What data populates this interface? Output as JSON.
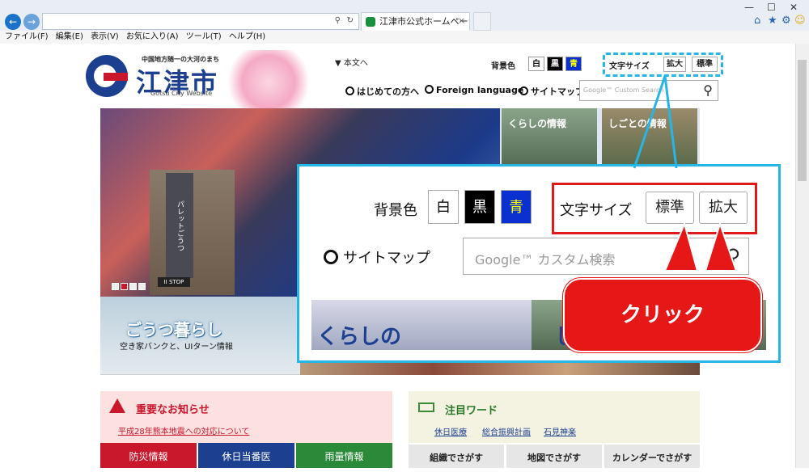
{
  "browser": {
    "back_icon": "back-arrow-icon",
    "forward_icon": "forward-arrow-icon",
    "tab_title": "江津市公式ホームページ",
    "menu": [
      "ファイル(F)",
      "編集(E)",
      "表示(V)",
      "お気に入り(A)",
      "ツール(T)",
      "ヘルプ(H)"
    ]
  },
  "header": {
    "tagline": "中国地方随一の大河のまち",
    "city_name": "江津市",
    "city_en": "Gotsu City Website",
    "skip_link": "本文へ",
    "bg_label": "背景色",
    "bg_options": [
      "白",
      "黒",
      "青"
    ],
    "size_label": "文字サイズ",
    "size_options": [
      "拡大",
      "標準"
    ],
    "nav": [
      "はじめての方へ",
      "Foreign language",
      "サイトマップ"
    ],
    "search_placeholder": "Google™ Custom Search"
  },
  "hero": {
    "building_sign": "パレットごうつ",
    "stop_label": "II STOP",
    "cards": [
      "くらしの情報",
      "しごとの情報"
    ]
  },
  "banner": {
    "title": "ごうつ暮らし",
    "subtitle": "空き家バンクと、UIターン情報"
  },
  "zoom": {
    "bg_label": "背景色",
    "bg_options": [
      "白",
      "黒",
      "青"
    ],
    "size_label": "文字サイズ",
    "size_options": [
      "標準",
      "拡大"
    ],
    "sitemap": "サイトマップ",
    "search_placeholder": "Google™ カスタム検索",
    "photo1_text": "くらしの",
    "photo2_text": "し",
    "callout": "クリック"
  },
  "notice": {
    "title": "重要なお知らせ",
    "link": "平成28年熊本地震への対応について"
  },
  "tabs": [
    "防災情報",
    "休日当番医",
    "雨量情報"
  ],
  "keywords": {
    "title": "注目ワード",
    "items": [
      "休日医療",
      "総合振興計画",
      "石見神楽"
    ]
  },
  "find_buttons": [
    "組織でさがす",
    "地図でさがす",
    "カレンダーでさがす"
  ],
  "colors": {
    "brand_blue": "#1c3f8f",
    "accent_red": "#c9182c",
    "callout_red": "#e61717",
    "highlight_cyan": "#26b6e6"
  }
}
